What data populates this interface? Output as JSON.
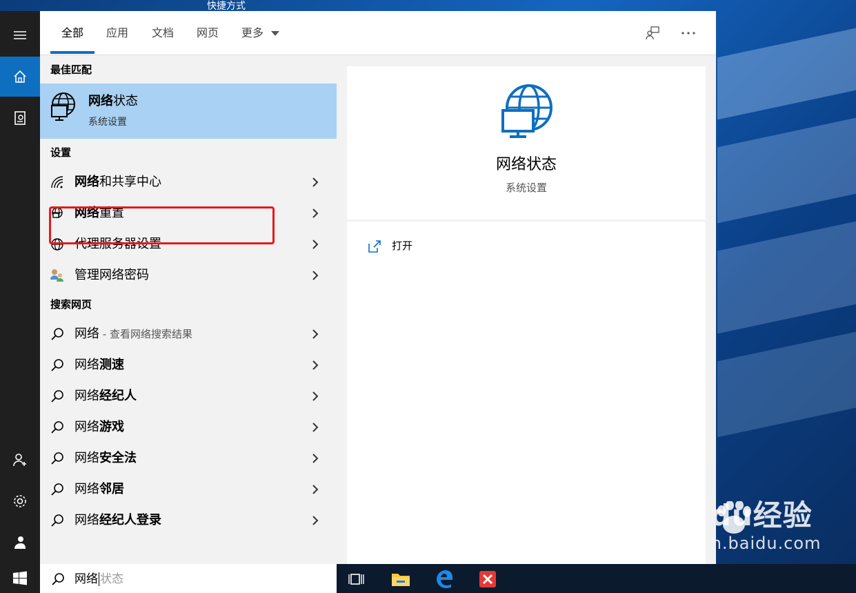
{
  "desktop": {
    "title": "快捷方式"
  },
  "watermark": {
    "brand": "Baidu经验",
    "url": "jingyan.baidu.com"
  },
  "tabs": [
    {
      "label": "全部",
      "active": true
    },
    {
      "label": "应用"
    },
    {
      "label": "文档"
    },
    {
      "label": "网页"
    },
    {
      "label": "更多"
    }
  ],
  "results": {
    "best_match_heading": "最佳匹配",
    "best_match": {
      "title_bold": "网络",
      "title_rest": "状态",
      "subtitle": "系统设置",
      "icon": "globe-monitor-icon"
    },
    "settings_heading": "设置",
    "settings": [
      {
        "bold": "网络",
        "rest": "和共享中心",
        "icon": "wifi-icon"
      },
      {
        "bold": "网络",
        "rest": "重置",
        "icon": "network-reset-icon"
      },
      {
        "bold": "",
        "rest": "代理服务器设置",
        "icon": "globe-icon"
      },
      {
        "bold": "",
        "rest": "管理网络密码",
        "icon": "credentials-icon"
      }
    ],
    "web_heading": "搜索网页",
    "web": [
      {
        "plain": "网络",
        "bold": "",
        "sub": " - 查看网络搜索结果"
      },
      {
        "plain": "网络",
        "bold": "测速"
      },
      {
        "plain": "网络",
        "bold": "经纪人"
      },
      {
        "plain": "网络",
        "bold": "游戏"
      },
      {
        "plain": "网络",
        "bold": "安全法"
      },
      {
        "plain": "网络",
        "bold": "邻居"
      },
      {
        "plain": "网络",
        "bold": "经纪人登录"
      }
    ]
  },
  "preview": {
    "title": "网络状态",
    "subtitle": "系统设置",
    "action_open": "打开"
  },
  "search": {
    "typed": "网络",
    "suggestion": "状态"
  },
  "colors": {
    "accent": "#0e6fc0",
    "highlight": "#a9d1f3",
    "annotation": "#e8171b"
  }
}
